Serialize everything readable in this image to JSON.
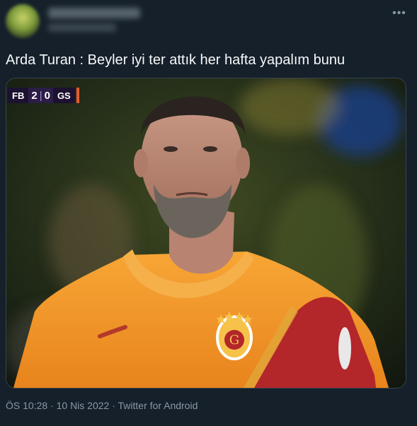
{
  "tweet": {
    "more_icon": "more-horizontal-icon",
    "text": "Arda Turan : Beyler iyi ter attık her hafta yapalım bunu",
    "time": "ÖS 10:28",
    "dot1": "·",
    "date": "10 Nis 2022",
    "dot2": "·",
    "source": "Twitter for Android"
  },
  "scoreboard": {
    "home_team": "FB",
    "home_score": "2",
    "separator": "|",
    "away_score": "0",
    "away_team": "GS"
  },
  "colors": {
    "background": "#15202b",
    "text": "#f7f9f9",
    "secondary_text": "#8b98a5",
    "jersey_orange": "#f39a2a",
    "jersey_red": "#b3262a"
  }
}
